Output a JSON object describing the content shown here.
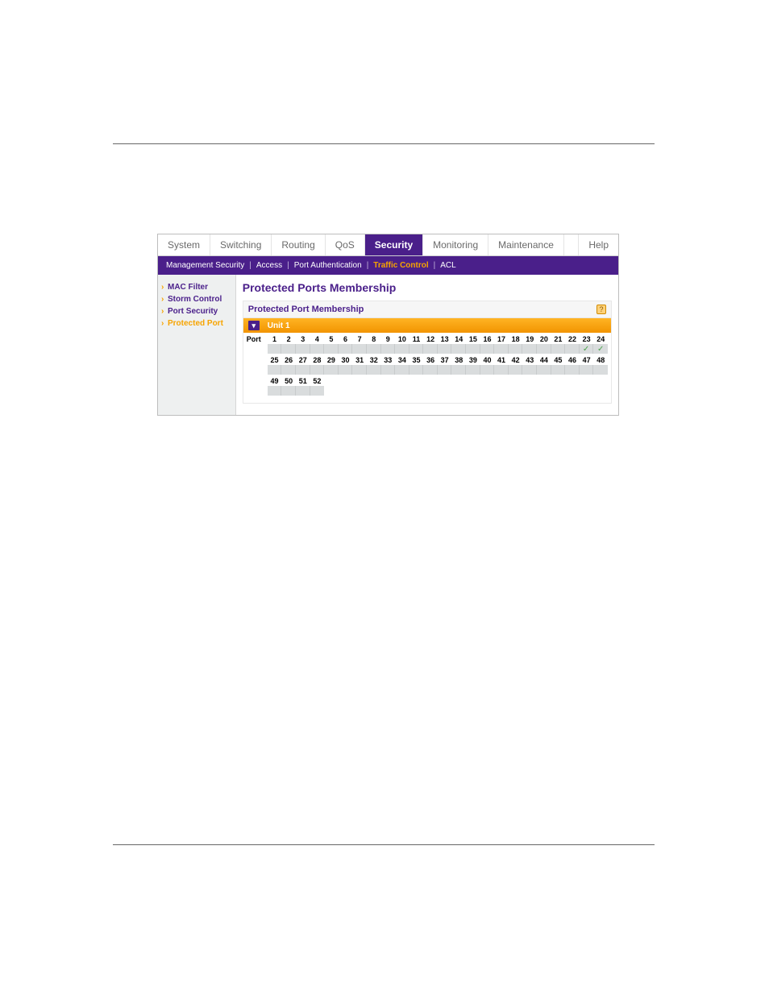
{
  "tabs": {
    "system": "System",
    "switching": "Switching",
    "routing": "Routing",
    "qos": "QoS",
    "security": "Security",
    "monitoring": "Monitoring",
    "maintenance": "Maintenance",
    "help": "Help"
  },
  "subtabs": {
    "mgmt": "Management Security",
    "access": "Access",
    "portauth": "Port Authentication",
    "traffic": "Traffic Control",
    "acl": "ACL"
  },
  "sidebar": {
    "mac": "MAC Filter",
    "storm": "Storm Control",
    "portsec": "Port Security",
    "protected": "Protected Port"
  },
  "page": {
    "title": "Protected Ports Membership",
    "panel_title": "Protected Port Membership",
    "help_icon": "?",
    "unit_dd": "▾",
    "unit": "Unit 1",
    "port_lead": "Port"
  },
  "ports": {
    "row1": [
      "1",
      "2",
      "3",
      "4",
      "5",
      "6",
      "7",
      "8",
      "9",
      "10",
      "11",
      "12",
      "13",
      "14",
      "15",
      "16",
      "17",
      "18",
      "19",
      "20",
      "21",
      "22",
      "23",
      "24"
    ],
    "row2": [
      "25",
      "26",
      "27",
      "28",
      "29",
      "30",
      "31",
      "32",
      "33",
      "34",
      "35",
      "36",
      "37",
      "38",
      "39",
      "40",
      "41",
      "42",
      "43",
      "44",
      "45",
      "46",
      "47",
      "48"
    ],
    "row3": [
      "49",
      "50",
      "51",
      "52"
    ],
    "selected": [
      "23",
      "24"
    ]
  }
}
